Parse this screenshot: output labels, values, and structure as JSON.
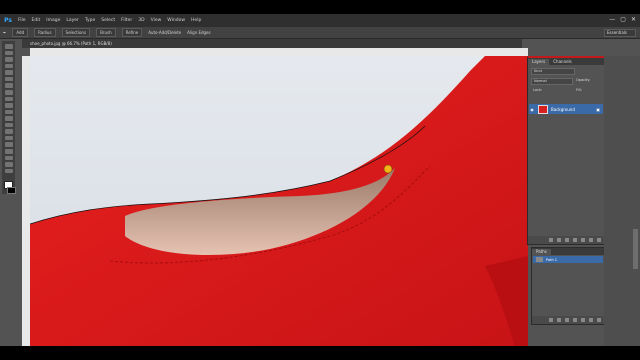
{
  "app": {
    "logo": "Ps"
  },
  "menu": [
    "File",
    "Edit",
    "Image",
    "Layer",
    "Type",
    "Select",
    "Filter",
    "3D",
    "View",
    "Window",
    "Help"
  ],
  "window_controls": [
    "—",
    "▢",
    "✕"
  ],
  "options_bar": {
    "mode": "Add",
    "feather": "Radius",
    "style": "Selections",
    "size": "Brush",
    "refine": "Refine",
    "auto": "Auto-Add/Delete",
    "align": "Align Edges"
  },
  "workspace": "Essentials",
  "document_tab": "shoe_photo.jpg @ 66.7% (Path 1, RGB/8)",
  "layers_panel": {
    "tabs": [
      "Layers",
      "Channels"
    ],
    "kind": "Kind",
    "blend": "Normal",
    "opacity_label": "Opacity:",
    "lock_label": "Lock:",
    "fill_label": "Fill:",
    "layer_name": "Background"
  },
  "paths_panel": {
    "tab": "Paths",
    "path_name": "Path 1"
  },
  "colors": {
    "accent_red": "#c2191d",
    "selection_blue": "#3b6aa8",
    "shoe_red": "#e0191b",
    "background": "#dfe4ea"
  },
  "icons": [
    "photoshop-logo",
    "eye-icon",
    "lock-icon",
    "new-layer-icon",
    "trash-icon",
    "pen-tool-icon",
    "pen-cursor-icon"
  ]
}
